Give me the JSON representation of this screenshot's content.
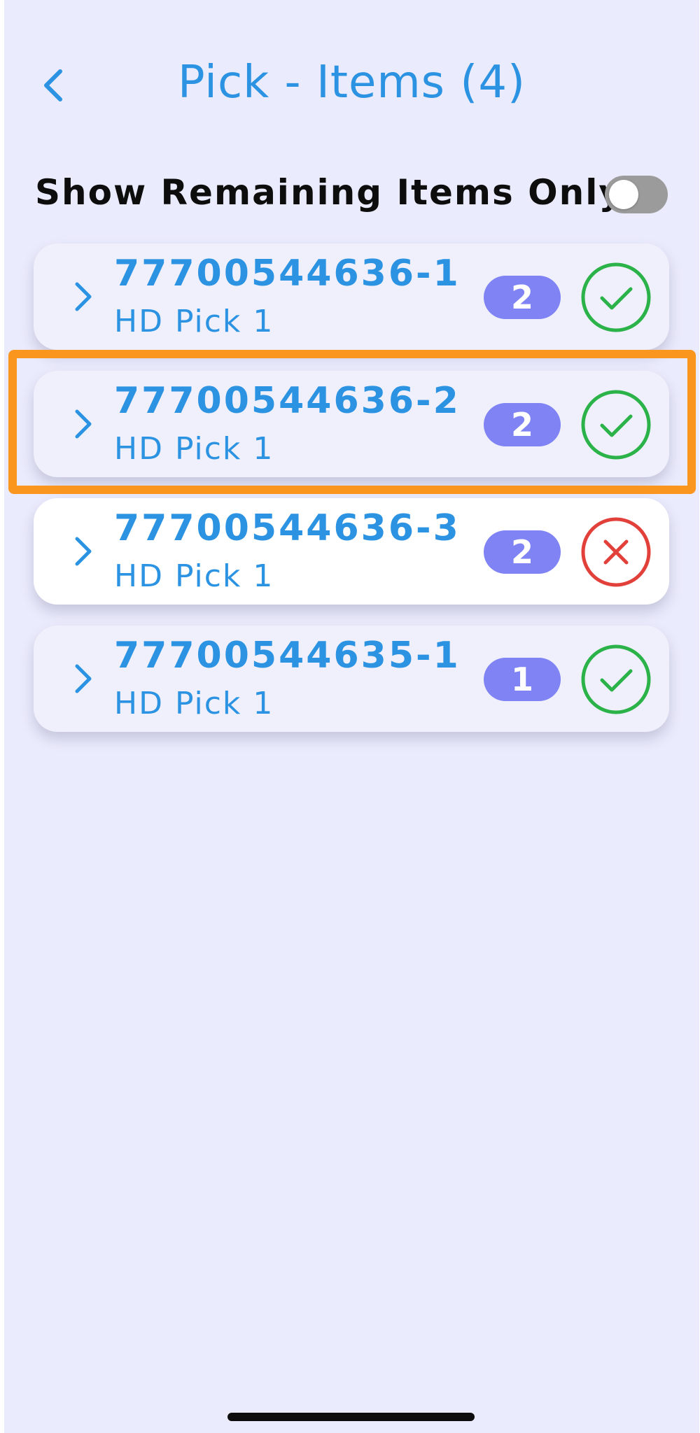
{
  "header": {
    "title": "Pick - Items (4)"
  },
  "filter": {
    "label": "Show Remaining Items Only",
    "toggle_on": false
  },
  "items": [
    {
      "id": "77700544636-1",
      "subtitle": "HD Pick 1",
      "quantity": "2",
      "status": "done",
      "status_icon": "check-circle-icon"
    },
    {
      "id": "77700544636-2",
      "subtitle": "HD Pick 1",
      "quantity": "2",
      "status": "done",
      "status_icon": "check-circle-icon",
      "highlighted": true
    },
    {
      "id": "77700544636-3",
      "subtitle": "HD Pick 1",
      "quantity": "2",
      "status": "missing",
      "status_icon": "x-circle-icon"
    },
    {
      "id": "77700544635-1",
      "subtitle": "HD Pick 1",
      "quantity": "1",
      "status": "done",
      "status_icon": "check-circle-icon"
    }
  ],
  "colors": {
    "background": "#eaebfc",
    "accent": "#2b93e2",
    "badge": "#7f83f4",
    "success": "#2bb34a",
    "error": "#e2403a",
    "highlight": "#fa961e",
    "card_done": "#eff0fb",
    "card_default": "#ffffff"
  }
}
